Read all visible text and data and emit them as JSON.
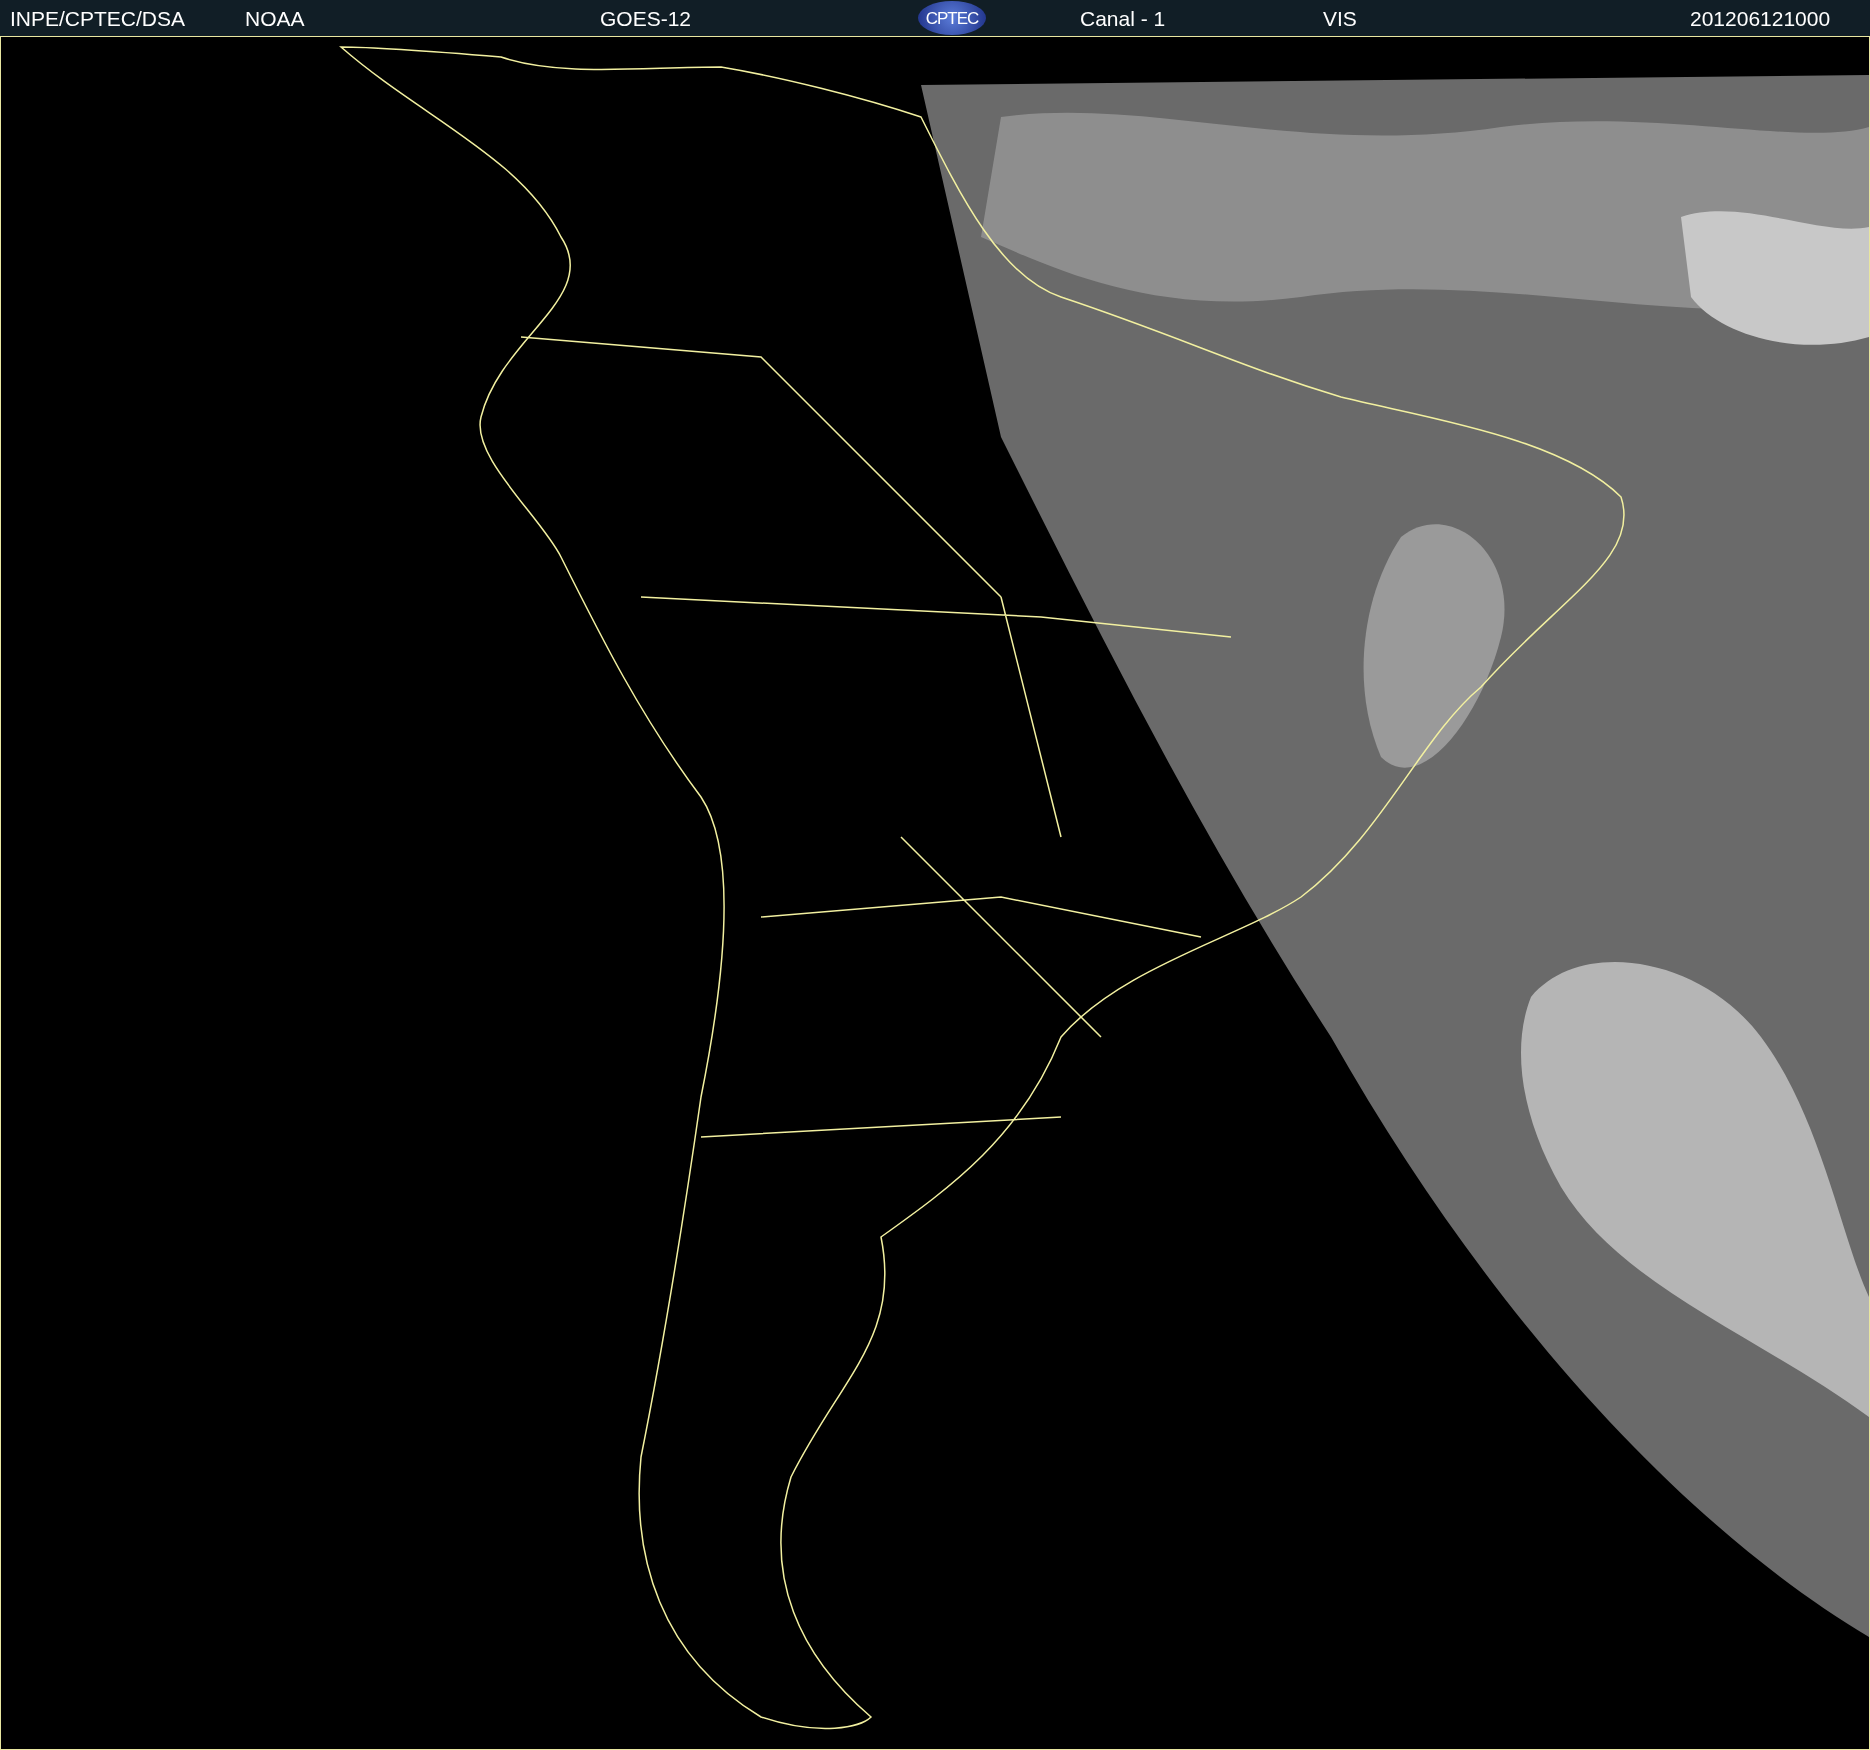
{
  "header": {
    "source": "INPE/CPTEC/DSA",
    "agency": "NOAA",
    "satellite": "GOES-12",
    "logo": "CPTEC",
    "channel": "Canal - 1",
    "band": "VIS",
    "timestamp": "201206121000"
  }
}
